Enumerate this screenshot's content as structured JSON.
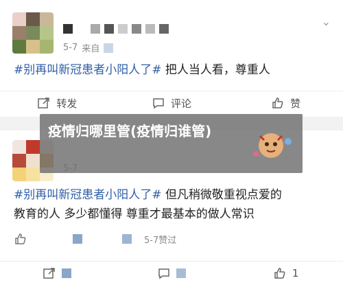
{
  "post1": {
    "time": "5-7",
    "source": "来自",
    "text_tag": "#别再叫新冠患者小阳人了#",
    "text_rest": "把人当人看，尊重人",
    "actions": {
      "repost": "转发",
      "comment": "评论",
      "like": "赞"
    }
  },
  "post2": {
    "time": "5-7",
    "text_tag": "#别再叫新冠患者小阳人了#",
    "text_rest_line1": "但凡稍微敬重视点爱的",
    "text_line2": "教育的人 多少都懂得 尊重才最基本的做人常识",
    "time2": "5-7赞过",
    "actions": {
      "like_count": "1"
    }
  },
  "overlay": {
    "title": "疫情归哪里管(疫情归谁管)"
  },
  "colors": {
    "tag": "#2f5fa8",
    "overlay": "#6e6e6e"
  }
}
